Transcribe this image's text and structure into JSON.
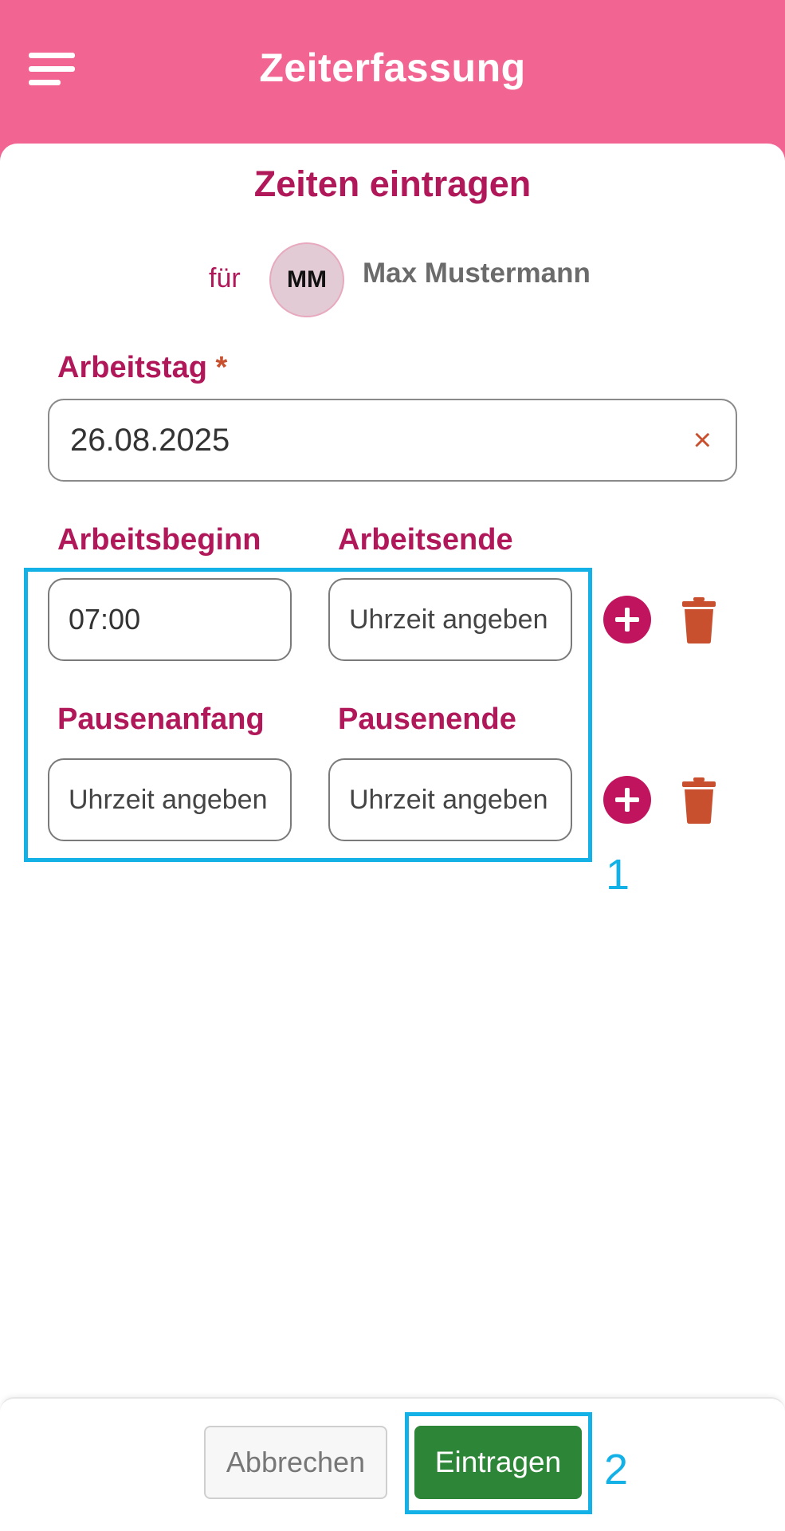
{
  "header": {
    "title": "Zeiterfassung",
    "menu_icon": "hamburger-menu-icon"
  },
  "form": {
    "title": "Zeiten eintragen",
    "for_label": "für",
    "person": {
      "initials": "MM",
      "name": "Max Mustermann"
    },
    "workday": {
      "label": "Arbeitstag",
      "required_mark": "*",
      "value": "26.08.2025",
      "clear_icon": "×"
    },
    "work_times": {
      "start_label": "Arbeitsbeginn",
      "end_label": "Arbeitsende",
      "start_value": "07:00",
      "end_placeholder": "Uhrzeit angeben"
    },
    "break_times": {
      "start_label": "Pausenanfang",
      "end_label": "Pausenende",
      "start_placeholder": "Uhrzeit angeben",
      "end_placeholder": "Uhrzeit angeben"
    }
  },
  "footer": {
    "cancel_label": "Abbrechen",
    "submit_label": "Eintragen"
  },
  "annotations": {
    "marker_1": "1",
    "marker_2": "2",
    "highlight_color": "#14b1e7"
  },
  "colors": {
    "brand_pink": "#f26492",
    "label_magenta": "#b0185a",
    "add_button": "#c0155e",
    "delete_orange": "#c8502e",
    "submit_green": "#2d8537"
  }
}
